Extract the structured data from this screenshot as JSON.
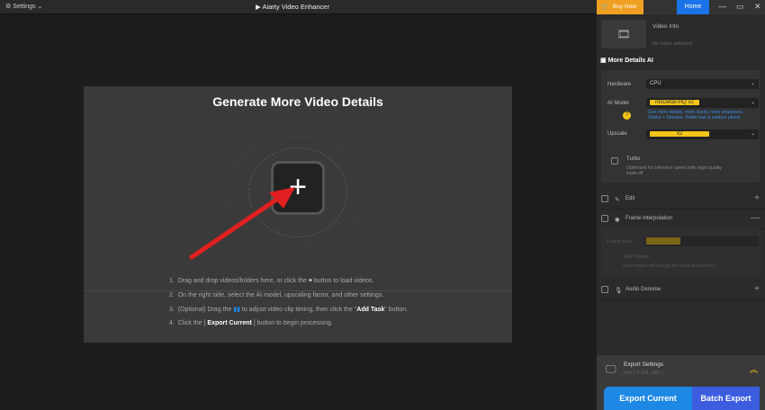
{
  "titlebar": {
    "settings": "Settings",
    "title": "Aiarty Video Enhancer"
  },
  "main": {
    "heading": "Generate More Video Details",
    "add_icon": "+",
    "steps": [
      {
        "num": "1.",
        "pre": "Drag and drop videos/folders here, or click the ",
        "icon": "+",
        "post": " button to load videos."
      },
      {
        "num": "2.",
        "text": "On the right side, select the AI model, upscaling factor, and other settings."
      },
      {
        "num": "3.",
        "pre": "(Optional) Drag the ",
        "post": " to adjust video clip timing, then click the \"",
        "bold": "Add Task",
        "post2": "\" button."
      },
      {
        "num": "4.",
        "pre": "Click the [ ",
        "bold": "Export Current",
        "post": " ] button to begin processing."
      }
    ]
  },
  "sidebar": {
    "buy_now": "Buy Now",
    "home": "Home",
    "video_info": "Video Info",
    "no_video": "No video selected",
    "more_details": "More Details AI",
    "hardware_label": "Hardware",
    "hardware": "CPU",
    "ai_model_label": "AI Model",
    "ai_model": "moDetail-HQ  v2",
    "model_desc": "Gen more details, more clarity, more sharpness. Deblur + Denoise. Better hair & outdoor plants",
    "upscale_label": "Upscale",
    "upscale": "x2",
    "turbo": "Turbo",
    "turbo_desc": "Optimized for inference speed with slight quality trade-off",
    "edit": "Edit",
    "frame_interp": "Frame Interpolation",
    "frame_rate_label": "Frame Rate",
    "slow_motion": "Slow Motion",
    "slow_desc": "Slow motion will change the video duration to 2",
    "audio_denoise": "Audio Denoise",
    "export_settings": "Export Settings",
    "export_format": "mp4 | H.264 , AAC |",
    "export_current": "Export Current",
    "batch_export": "Batch Export"
  },
  "colors": {
    "accent": "#1e88e5",
    "buy": "#f0a020",
    "chip": "#f5c518",
    "arrow": "#e02020"
  }
}
